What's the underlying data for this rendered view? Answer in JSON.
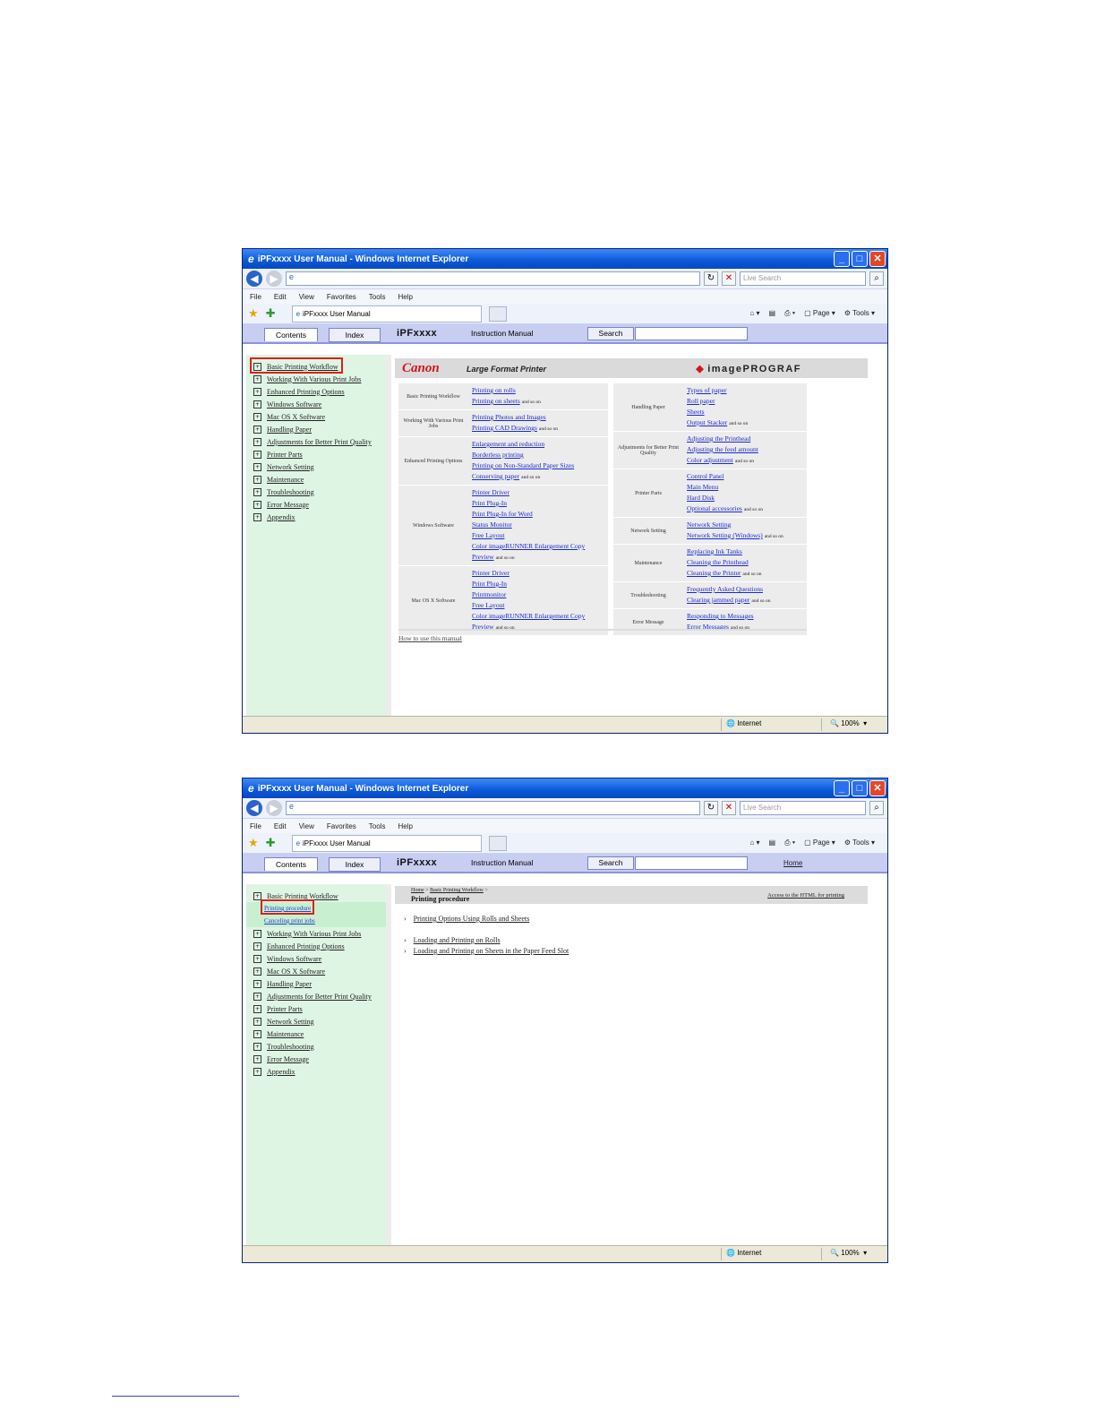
{
  "window": {
    "title": "iPFxxxx User Manual - Windows Internet Explorer",
    "live_search_placeholder": "Live Search",
    "menu": [
      "File",
      "Edit",
      "View",
      "Favorites",
      "Tools",
      "Help"
    ],
    "tab_label": "iPFxxxx User Manual",
    "command_bar": {
      "page": "Page",
      "tools": "Tools"
    },
    "status": {
      "zone": "Internet",
      "zoom": "100%"
    }
  },
  "helpbar": {
    "contents": "Contents",
    "index": "Index",
    "brand": "iPFxxxx",
    "instruction_manual": "Instruction Manual",
    "search": "Search",
    "home": "Home"
  },
  "sidebar": {
    "items": [
      "Basic Printing Workflow",
      "Working With Various Print Jobs",
      "Enhanced Printing Options",
      "Windows Software",
      "Mac OS X Software",
      "Handling Paper",
      "Adjustments for Better Print Quality",
      "Printer Parts",
      "Network Setting",
      "Maintenance",
      "Troubleshooting",
      "Error Message",
      "Appendix"
    ],
    "subitems": [
      "Printing procedure",
      "Canceling print jobs"
    ]
  },
  "home_page": {
    "canon_logo": "Canon",
    "large_format": "Large Format Printer",
    "imageprograf": "imagePROGRAF",
    "left_categories": [
      {
        "label": "Basic Printing Workflow",
        "links": [
          "Printing on rolls",
          "Printing on sheets"
        ],
        "so_on": "and so on"
      },
      {
        "label": "Working With Various Print Jobs",
        "links": [
          "Printing Photos and Images",
          "Printing CAD Drawings"
        ],
        "so_on": "and so on"
      },
      {
        "label": "Enhanced Printing Options",
        "links": [
          "Enlargement and reduction",
          "Borderless printing",
          "Printing on Non-Standard Paper Sizes",
          "Conserving paper"
        ],
        "so_on": "and so on"
      },
      {
        "label": "Windows Software",
        "links": [
          "Printer Driver",
          "Print Plug-In",
          "Print Plug-In for Word",
          "Status Monitor",
          "Free Layout",
          "Color imageRUNNER Enlargement Copy",
          "Preview"
        ],
        "so_on": "and so on"
      },
      {
        "label": "Mac OS X Software",
        "links": [
          "Printer Driver",
          "Print Plug-In",
          "Printmonitor",
          "Free Layout",
          "Color imageRUNNER Enlargement Copy",
          "Preview"
        ],
        "so_on": "and so on"
      }
    ],
    "right_categories": [
      {
        "label": "Handling Paper",
        "links": [
          "Types of paper",
          "Roll paper",
          "Sheets",
          "Output Stacker"
        ],
        "so_on": "and so on"
      },
      {
        "label": "Adjustments for Better Print Quality",
        "links": [
          "Adjusting the Printhead",
          "Adjusting the feed amount",
          "Color adjustment"
        ],
        "so_on": "and so on"
      },
      {
        "label": "Printer Parts",
        "links": [
          "Control Panel",
          "Main Menu",
          "Hard Disk",
          "Optional accessories"
        ],
        "so_on": "and so on"
      },
      {
        "label": "Network Setting",
        "links": [
          "Network Setting",
          "Network Setting (Windows)"
        ],
        "so_on": "and so on"
      },
      {
        "label": "Maintenance",
        "links": [
          "Replacing Ink Tanks",
          "Cleaning the Printhead",
          "Cleaning the Printer"
        ],
        "so_on": "and so on"
      },
      {
        "label": "Troubleshooting",
        "links": [
          "Frequently Asked Questions",
          "Clearing jammed paper"
        ],
        "so_on": "and so on"
      },
      {
        "label": "Error Message",
        "links": [
          "Responding to Messages",
          "Error Messages"
        ],
        "so_on": "and so on"
      }
    ],
    "howto": "How to use this manual"
  },
  "procedure_page": {
    "breadcrumb": [
      "Home",
      "Basic Printing Workflow"
    ],
    "title": "Printing procedure",
    "print_link": "Access to the HTML for printing",
    "links": [
      "Printing Options Using Rolls and Sheets",
      "Loading and Printing on Rolls",
      "Loading and Printing on Sheets in the Paper Feed Slot"
    ]
  }
}
